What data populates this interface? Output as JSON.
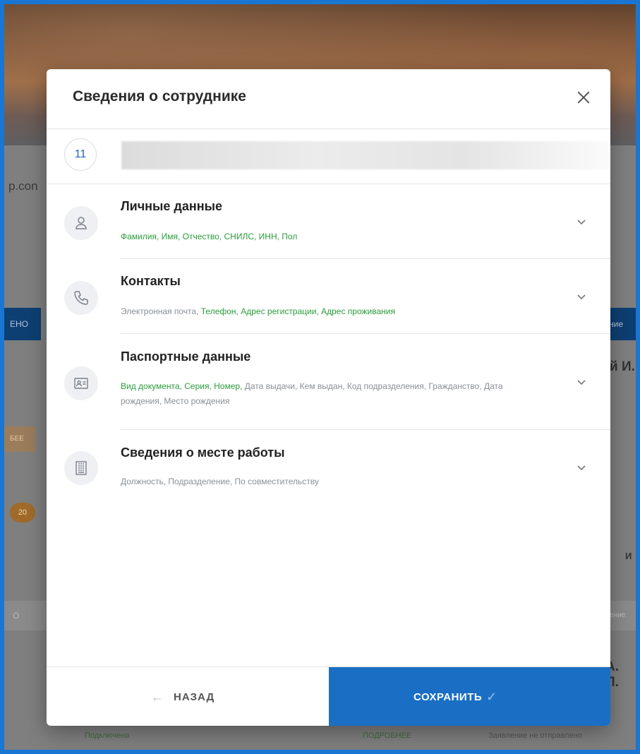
{
  "background": {
    "partial_texts": [
      "p.con",
      "ЕНО",
      "ние",
      "й И.",
      "БЕЕ",
      "20",
      "И",
      "О",
      "ение",
      "А. П.",
      "Подключена",
      "ПОДРОБНЕЕ",
      "Заявление не отправлено"
    ]
  },
  "modal": {
    "title": "Сведения о сотруднике",
    "employee": {
      "number": "11"
    },
    "sections": [
      {
        "title": "Личные данные",
        "icon": "person-icon",
        "fields": [
          {
            "text": "Фамилия, Имя, Отчество, СНИЛС, ИНН, Пол",
            "status": "ok"
          }
        ]
      },
      {
        "title": "Контакты",
        "icon": "phone-icon",
        "fields": [
          {
            "text": "Электронная почта, ",
            "status": "missing"
          },
          {
            "text": "Телефон, Адрес регистрации, Адрес проживания",
            "status": "ok"
          }
        ]
      },
      {
        "title": "Паспортные данные",
        "icon": "id-card-icon",
        "fields": [
          {
            "text": "Вид документа, Серия, Номер, ",
            "status": "ok"
          },
          {
            "text": "Дата выдачи, Кем выдан, Код подразделения, Гражданство, Дата рождения, Место рождения",
            "status": "missing"
          }
        ]
      },
      {
        "title": "Сведения о месте работы",
        "icon": "building-icon",
        "fields": [
          {
            "text": "Должность, Подразделение, По совместительству",
            "status": "missing"
          }
        ]
      }
    ],
    "footer": {
      "back_label": "НАЗАД",
      "save_label": "СОХРАНИТЬ"
    }
  },
  "colors": {
    "accent": "#1a6fc4",
    "ok": "#2a9d3a",
    "missing": "#8a8f96",
    "frame": "#1976d2"
  }
}
